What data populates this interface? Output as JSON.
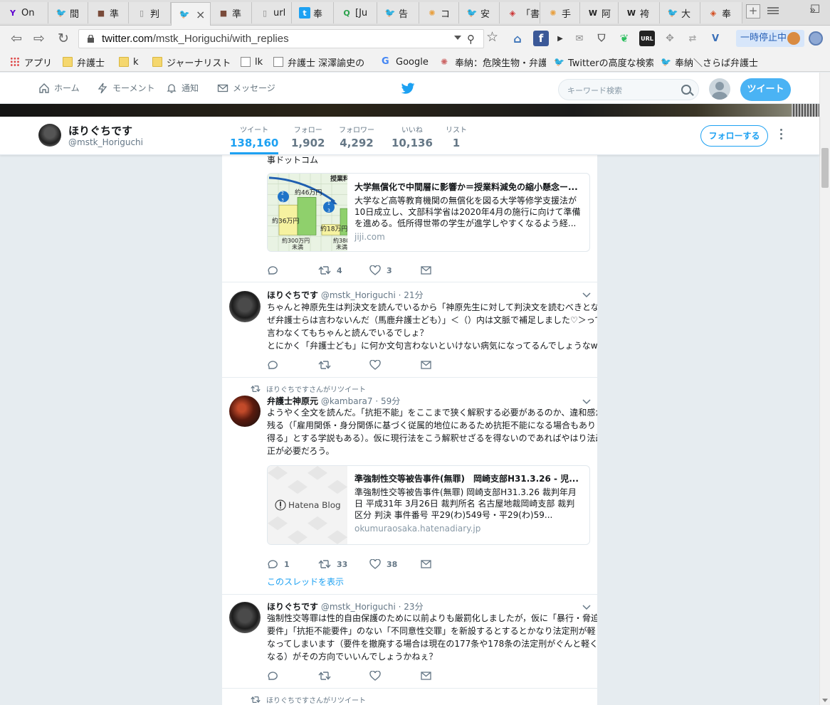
{
  "browser": {
    "tabs": [
      {
        "label": "On",
        "icon": "yahoo-icon",
        "color": "#5f01d1"
      },
      {
        "label": "間",
        "icon": "twitter-icon",
        "color": "#1da1f2"
      },
      {
        "label": "準",
        "icon": "profile-photo-icon",
        "color": "#7a4b3a"
      },
      {
        "label": "判",
        "icon": "page-icon",
        "color": "#888888"
      },
      {
        "label": "",
        "icon": "twitter-icon",
        "color": "#1da1f2"
      },
      {
        "label": "準",
        "icon": "profile-photo-icon",
        "color": "#7a4b3a"
      },
      {
        "label": "url",
        "icon": "page-icon",
        "color": "#888888"
      },
      {
        "label": "奉",
        "icon": "twitter-blue-icon",
        "color": "#1da1f2"
      },
      {
        "label": "[Ju",
        "icon": "q-icon",
        "color": "#2ba24c"
      },
      {
        "label": "告",
        "icon": "twitter-icon",
        "color": "#1da1f2"
      },
      {
        "label": "コ",
        "icon": "sun-icon",
        "color": "#e8a142"
      },
      {
        "label": "安",
        "icon": "twitter-icon",
        "color": "#1da1f2"
      },
      {
        "label": "「書",
        "icon": "site-icon",
        "color": "#c33"
      },
      {
        "label": "手",
        "icon": "sun-icon",
        "color": "#e8a142"
      },
      {
        "label": "阿",
        "icon": "wikipedia-icon",
        "color": "#222"
      },
      {
        "label": "袴",
        "icon": "wikipedia-icon",
        "color": "#222"
      },
      {
        "label": "大",
        "icon": "twitter-icon",
        "color": "#1da1f2"
      },
      {
        "label": "奉",
        "icon": "site-icon",
        "color": "#d34a1c"
      }
    ],
    "url_host": "twitter.com",
    "url_path": "/mstk_Horiguchi/with_replies",
    "pause_label": "一時停止中",
    "bookmarks": [
      {
        "label": "アプリ",
        "icon": "apps-grid-icon"
      },
      {
        "label": "弁護士",
        "icon": "folder-icon"
      },
      {
        "label": "k",
        "icon": "folder-icon"
      },
      {
        "label": "ジャーナリスト",
        "icon": "folder-icon"
      },
      {
        "label": "lk",
        "icon": "page-icon"
      },
      {
        "label": "弁護士 深澤諭史の",
        "icon": "page-icon"
      },
      {
        "label": "Google",
        "icon": "google-icon"
      },
      {
        "label": "奉納：危険生物・弁護",
        "icon": "site-icon"
      },
      {
        "label": "Twitterの高度な検索",
        "icon": "twitter-icon"
      },
      {
        "label": "奉納＼さらば弁護士",
        "icon": "twitter-icon"
      }
    ]
  },
  "twitter_nav": {
    "home": "ホーム",
    "moments": "モーメント",
    "notifications": "通知",
    "messages": "メッセージ",
    "search_placeholder": "キーワード検索",
    "tweet_button": "ツイート"
  },
  "profile": {
    "name": "ほりぐちです",
    "handle": "@mstk_Horiguchi",
    "stats": [
      {
        "label": "ツイート",
        "value": "138,160",
        "active": true
      },
      {
        "label": "フォロー",
        "value": "1,902",
        "active": false
      },
      {
        "label": "フォロワー",
        "value": "4,292",
        "active": false
      },
      {
        "label": "いいね",
        "value": "10,136",
        "active": false
      },
      {
        "label": "リスト",
        "value": "1",
        "active": false
      }
    ],
    "follow_button": "フォローする"
  },
  "timeline": {
    "t0": {
      "source_line": "事ドットコム",
      "card": {
        "title": "大学無償化で中間層に影響か＝授業料減免の縮小懸念ー...",
        "desc": [
          "大学など高等教育機関の無償化を図る大学等修学支援法が",
          "10日成立し、文部科学省は2020年4月の施行に向けて準備",
          "を進める。低所得世帯の学生が進学しやすくなるよう経..."
        ],
        "domain": "jiji.com",
        "img_labels": {
          "top": "授業料",
          "a": "約46万円",
          "b": "約36万円",
          "c": "約18万円",
          "d": "約300万円",
          "e": "未満",
          "f": "約380",
          "g": "未満"
        }
      },
      "replies": "",
      "retweets": "4",
      "likes": "3"
    },
    "t1": {
      "name": "ほりぐちです",
      "handle": "@mstk_Horiguchi",
      "time": "· 21分",
      "text": [
        "ちゃんと神原先生は判決文を読んでいるから「神原先生に対して判決文を読むべきとな",
        "ぜ弁護士らは言わないんだ（馬鹿弁護士ども）」＜（）内は文脈で補足しました♡＞って",
        "言わなくてもちゃんと読んでいるでしょ？",
        "とにかく「弁護士ども」に何か文句言わないといけない病気になってるんでしょうなw"
      ],
      "replies": "",
      "retweets": "",
      "likes": ""
    },
    "t2": {
      "retweet_note": "ほりぐちですさんがリツイート",
      "name": "弁護士神原元",
      "handle": "@kambara7",
      "time": "· 59分",
      "text": [
        "ようやく全文を読んだ。「抗拒不能」をここまで狭く解釈する必要があるのか、違和感が",
        "残る（「雇用関係・身分関係に基づく従属的地位にあるため抗拒不能になる場合もあり",
        "得る」とする学説もある）。仮に現行法をこう解釈せざるを得ないのであればやはり法改",
        "正が必要だろう。"
      ],
      "card": {
        "title": "準強制性交等被告事件(無罪)　岡崎支部H31.3.26 - 児...",
        "desc": [
          "準強制性交等被告事件(無罪) 岡崎支部H31.3.26 裁判年月",
          "日 平成31年 3月26日 裁判所名 名古屋地裁岡崎支部 裁判",
          "区分 判決 事件番号 平29(わ)549号・平29(わ)59..."
        ],
        "domain": "okumuraosaka.hatenadiary.jp",
        "img_label": "Hatena Blog"
      },
      "replies": "1",
      "retweets": "33",
      "likes": "38",
      "thread_link": "このスレッドを表示"
    },
    "t3": {
      "name": "ほりぐちです",
      "handle": "@mstk_Horiguchi",
      "time": "· 23分",
      "text": [
        "強制性交等罪は性的自由保護のために以前よりも厳罰化しましたが，仮に「暴行・脅迫",
        "要件」「抗拒不能要件」のない「不同意性交罪」を新設するとするとかなり法定刑が軽く",
        "なってしまいます（要件を撤廃する場合は現在の177条や178条の法定刑がぐんと軽く",
        "なる）がその方向でいいんでしょうかねぇ？"
      ],
      "replies": "",
      "retweets": "",
      "likes": ""
    },
    "t4": {
      "retweet_note": "ほりぐちですさんがリツイート"
    }
  }
}
